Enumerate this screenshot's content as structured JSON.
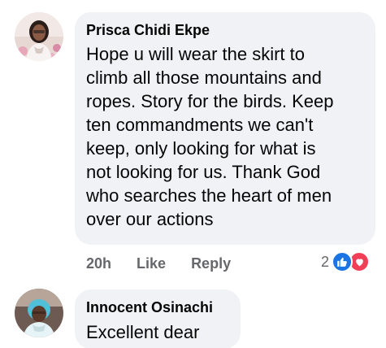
{
  "comments": [
    {
      "author": "Prisca Chidi Ekpe",
      "text": "Hope u will wear the skirt to\nclimb all those mountains and\nropes. Story for the birds. Keep\nten commandments we can't\nkeep, only looking for what is\nnot looking for us. Thank  God\nwho  searches the heart of men\nover our actions",
      "time": "20h",
      "like_label": "Like",
      "reply_label": "Reply",
      "reaction_count": "2",
      "reactions": [
        "like-icon",
        "love-icon"
      ]
    },
    {
      "author": "Innocent Osinachi",
      "text": "Excellent dear"
    }
  ],
  "colors": {
    "bubble": "#f0f2f5",
    "meta_text": "#65676b",
    "like_blue": "#1b74e4",
    "love_red": "#f33e58"
  }
}
